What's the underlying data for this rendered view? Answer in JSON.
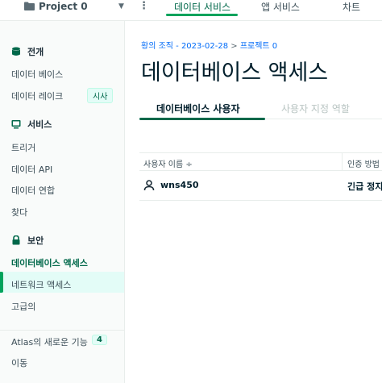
{
  "topbar": {
    "project_name": "Project 0",
    "tabs": [
      {
        "label": "데이터 서비스",
        "active": true
      },
      {
        "label": "앱 서비스",
        "active": false
      },
      {
        "label": "차트",
        "active": false
      }
    ]
  },
  "sidebar": {
    "sections": [
      {
        "title": "전개",
        "icon": "database-icon"
      },
      {
        "title": "서비스",
        "icon": "services-icon"
      },
      {
        "title": "보안",
        "icon": "lock-icon"
      }
    ],
    "items": {
      "database": "데이터 베이스",
      "datalake": "데이터 레이크",
      "datalake_badge": "시사",
      "triggers": "트리거",
      "data_api": "데이터 API",
      "federation": "데이터 연합",
      "search": "찾다",
      "db_access": "데이터베이스 액세스",
      "network_access": "네트워크 액세스",
      "advanced": "고급의",
      "whats_new": "Atlas의 새로운 기능",
      "whats_new_count": "4",
      "migrate": "이동"
    }
  },
  "main": {
    "breadcrumb": {
      "org": "황의 조직 - 2023-02-28",
      "separator": " > ",
      "project": "프로젝트 0"
    },
    "title": "데이터베이스 액세스",
    "tabs": [
      {
        "label": "데이터베이스 사용자",
        "active": true
      },
      {
        "label": "사용자 지정 역할",
        "active": false
      }
    ],
    "table": {
      "headers": [
        "사용자 이름 ÷",
        "인증 방법"
      ],
      "rows": [
        {
          "username": "wns450",
          "auth": "긴급 정지"
        }
      ]
    }
  },
  "colors": {
    "accent": "#00684a",
    "accent_bright": "#00a35c",
    "link": "#016bf8",
    "active_bg": "#e3fcf7"
  }
}
